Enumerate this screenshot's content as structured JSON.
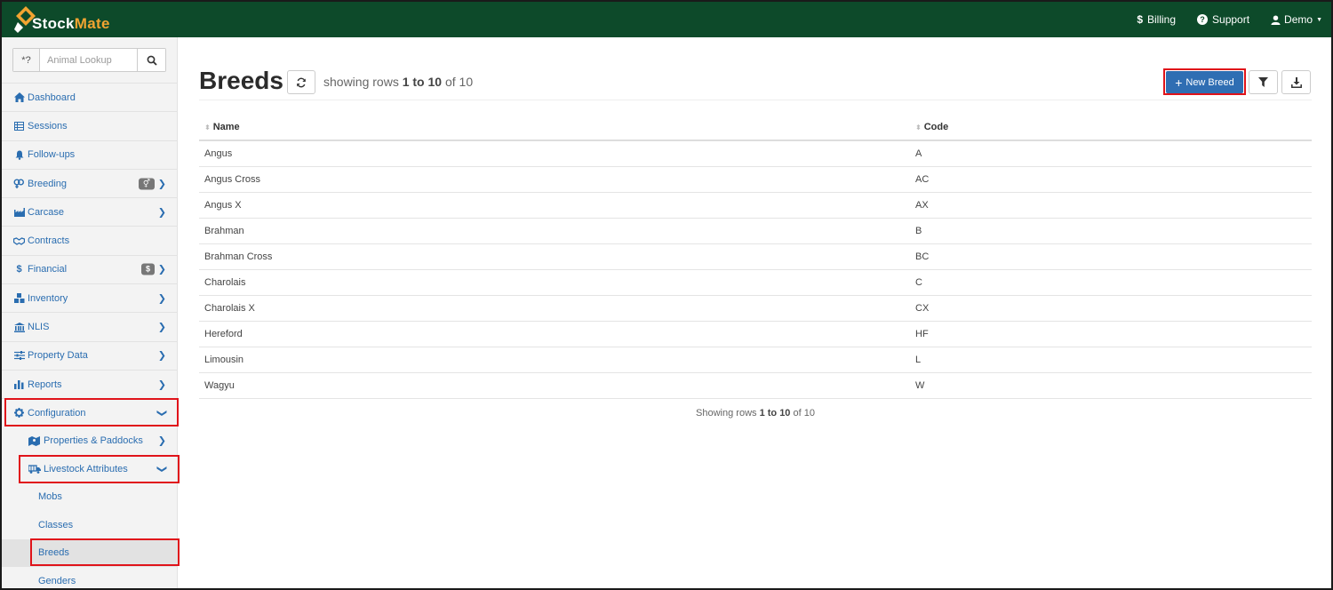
{
  "app": {
    "logo_stock": "Stock",
    "logo_mate": "Mate",
    "brand_color": "#0d4a2a",
    "accent_color": "#2f6eb3",
    "highlight_color": "#e0131a"
  },
  "topnav": {
    "billing": "Billing",
    "billing_icon": "$",
    "support": "Support",
    "support_icon": "?",
    "user": "Demo"
  },
  "sidebar": {
    "lookup_addon": "*?",
    "lookup_placeholder": "Animal Lookup",
    "items": [
      {
        "label": "Dashboard",
        "icon": "home-icon"
      },
      {
        "label": "Sessions",
        "icon": "table-icon"
      },
      {
        "label": "Follow-ups",
        "icon": "bell-icon"
      },
      {
        "label": "Breeding",
        "icon": "gender-icon",
        "badge": "⚥"
      },
      {
        "label": "Carcase",
        "icon": "factory-icon"
      },
      {
        "label": "Contracts",
        "icon": "handshake-icon"
      },
      {
        "label": "Financial",
        "icon": "dollar-icon",
        "badge": "$"
      },
      {
        "label": "Inventory",
        "icon": "boxes-icon"
      },
      {
        "label": "NLIS",
        "icon": "bank-icon"
      },
      {
        "label": "Property Data",
        "icon": "sliders-icon"
      },
      {
        "label": "Reports",
        "icon": "bar-chart-icon"
      },
      {
        "label": "Configuration",
        "icon": "gear-icon"
      }
    ],
    "sub_items": [
      {
        "label": "Properties & Paddocks",
        "icon": "map-icon"
      },
      {
        "label": "Livestock Attributes",
        "icon": "truck-icon"
      }
    ],
    "leaf_items": [
      {
        "label": "Mobs"
      },
      {
        "label": "Classes"
      },
      {
        "label": "Breeds"
      },
      {
        "label": "Genders"
      }
    ]
  },
  "main": {
    "title": "Breeds",
    "rows_prefix": "showing rows",
    "rows_range": "1 to 10",
    "rows_of": "of 10",
    "new_button": "New Breed",
    "footer_prefix": "Showing rows",
    "footer_range": "1 to 10",
    "footer_of": "of 10",
    "columns": [
      "Name",
      "Code"
    ],
    "rows": [
      {
        "name": "Angus",
        "code": "A"
      },
      {
        "name": "Angus Cross",
        "code": "AC"
      },
      {
        "name": "Angus X",
        "code": "AX"
      },
      {
        "name": "Brahman",
        "code": "B"
      },
      {
        "name": "Brahman Cross",
        "code": "BC"
      },
      {
        "name": "Charolais",
        "code": "C"
      },
      {
        "name": "Charolais X",
        "code": "CX"
      },
      {
        "name": "Hereford",
        "code": "HF"
      },
      {
        "name": "Limousin",
        "code": "L"
      },
      {
        "name": "Wagyu",
        "code": "W"
      }
    ]
  }
}
